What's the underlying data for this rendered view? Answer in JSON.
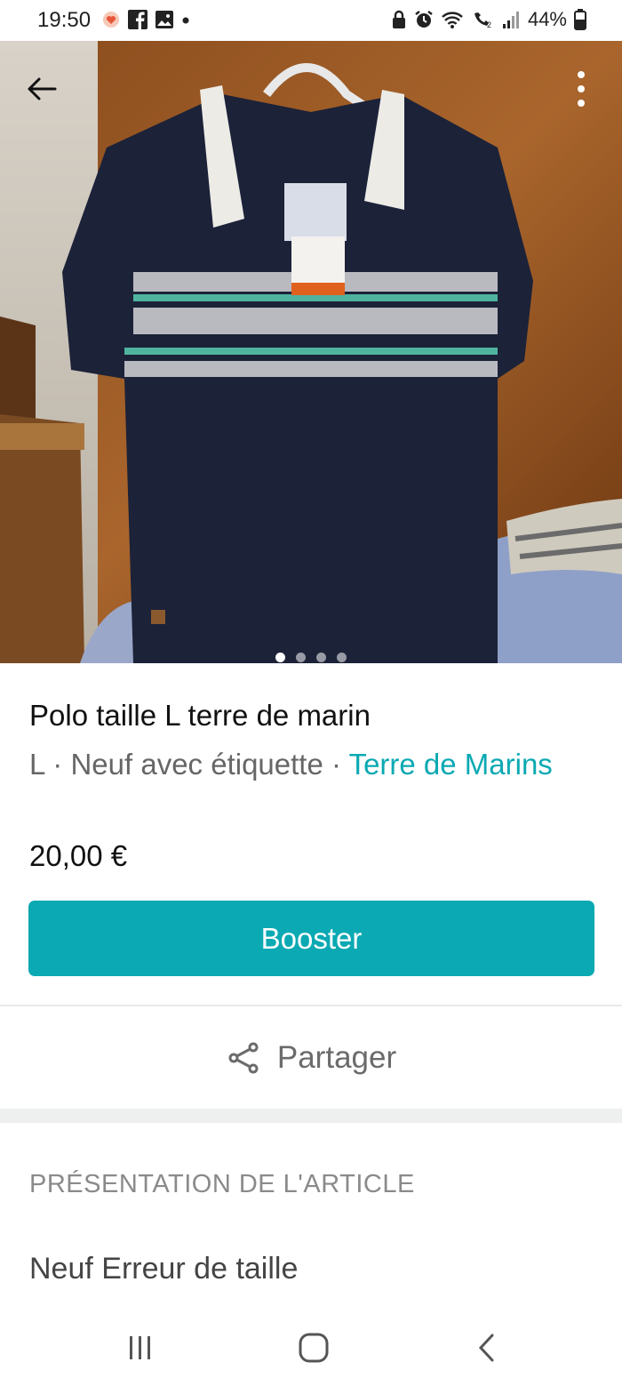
{
  "status_bar": {
    "time": "19:50",
    "battery": "44%",
    "icons": [
      "heart-notification-icon",
      "facebook-icon",
      "gallery-icon",
      "dot-icon",
      "lock-icon",
      "alarm-icon",
      "wifi-icon",
      "volte-icon",
      "signal-icon",
      "battery-icon"
    ]
  },
  "gallery": {
    "image_description": "",
    "dot_count": 4,
    "active_index": 0
  },
  "item": {
    "title": "Polo taille L terre de marin",
    "size": "L",
    "separator1": " · ",
    "condition": "Neuf avec étiquette",
    "separator2": " · ",
    "brand": "Terre de Marins",
    "price": "20,00 €"
  },
  "actions": {
    "booster_label": "Booster",
    "share_label": "Partager"
  },
  "presentation": {
    "section_title": "PRÉSENTATION DE L'ARTICLE",
    "description": "Neuf Erreur de taille"
  },
  "colors": {
    "accent": "#0aa9b3",
    "text_primary": "#111111",
    "text_secondary": "#666666"
  }
}
